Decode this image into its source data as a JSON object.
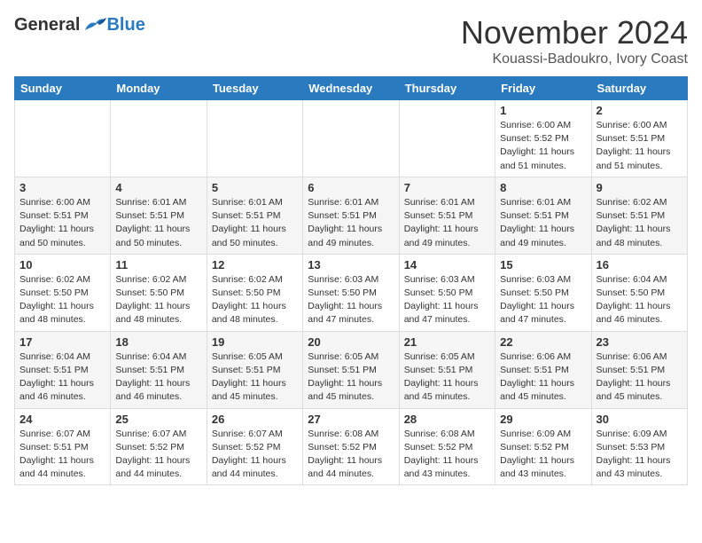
{
  "header": {
    "logo_general": "General",
    "logo_blue": "Blue",
    "month": "November 2024",
    "location": "Kouassi-Badoukro, Ivory Coast"
  },
  "weekdays": [
    "Sunday",
    "Monday",
    "Tuesday",
    "Wednesday",
    "Thursday",
    "Friday",
    "Saturday"
  ],
  "weeks": [
    [
      {
        "day": "",
        "info": ""
      },
      {
        "day": "",
        "info": ""
      },
      {
        "day": "",
        "info": ""
      },
      {
        "day": "",
        "info": ""
      },
      {
        "day": "",
        "info": ""
      },
      {
        "day": "1",
        "info": "Sunrise: 6:00 AM\nSunset: 5:52 PM\nDaylight: 11 hours\nand 51 minutes."
      },
      {
        "day": "2",
        "info": "Sunrise: 6:00 AM\nSunset: 5:51 PM\nDaylight: 11 hours\nand 51 minutes."
      }
    ],
    [
      {
        "day": "3",
        "info": "Sunrise: 6:00 AM\nSunset: 5:51 PM\nDaylight: 11 hours\nand 50 minutes."
      },
      {
        "day": "4",
        "info": "Sunrise: 6:01 AM\nSunset: 5:51 PM\nDaylight: 11 hours\nand 50 minutes."
      },
      {
        "day": "5",
        "info": "Sunrise: 6:01 AM\nSunset: 5:51 PM\nDaylight: 11 hours\nand 50 minutes."
      },
      {
        "day": "6",
        "info": "Sunrise: 6:01 AM\nSunset: 5:51 PM\nDaylight: 11 hours\nand 49 minutes."
      },
      {
        "day": "7",
        "info": "Sunrise: 6:01 AM\nSunset: 5:51 PM\nDaylight: 11 hours\nand 49 minutes."
      },
      {
        "day": "8",
        "info": "Sunrise: 6:01 AM\nSunset: 5:51 PM\nDaylight: 11 hours\nand 49 minutes."
      },
      {
        "day": "9",
        "info": "Sunrise: 6:02 AM\nSunset: 5:51 PM\nDaylight: 11 hours\nand 48 minutes."
      }
    ],
    [
      {
        "day": "10",
        "info": "Sunrise: 6:02 AM\nSunset: 5:50 PM\nDaylight: 11 hours\nand 48 minutes."
      },
      {
        "day": "11",
        "info": "Sunrise: 6:02 AM\nSunset: 5:50 PM\nDaylight: 11 hours\nand 48 minutes."
      },
      {
        "day": "12",
        "info": "Sunrise: 6:02 AM\nSunset: 5:50 PM\nDaylight: 11 hours\nand 48 minutes."
      },
      {
        "day": "13",
        "info": "Sunrise: 6:03 AM\nSunset: 5:50 PM\nDaylight: 11 hours\nand 47 minutes."
      },
      {
        "day": "14",
        "info": "Sunrise: 6:03 AM\nSunset: 5:50 PM\nDaylight: 11 hours\nand 47 minutes."
      },
      {
        "day": "15",
        "info": "Sunrise: 6:03 AM\nSunset: 5:50 PM\nDaylight: 11 hours\nand 47 minutes."
      },
      {
        "day": "16",
        "info": "Sunrise: 6:04 AM\nSunset: 5:50 PM\nDaylight: 11 hours\nand 46 minutes."
      }
    ],
    [
      {
        "day": "17",
        "info": "Sunrise: 6:04 AM\nSunset: 5:51 PM\nDaylight: 11 hours\nand 46 minutes."
      },
      {
        "day": "18",
        "info": "Sunrise: 6:04 AM\nSunset: 5:51 PM\nDaylight: 11 hours\nand 46 minutes."
      },
      {
        "day": "19",
        "info": "Sunrise: 6:05 AM\nSunset: 5:51 PM\nDaylight: 11 hours\nand 45 minutes."
      },
      {
        "day": "20",
        "info": "Sunrise: 6:05 AM\nSunset: 5:51 PM\nDaylight: 11 hours\nand 45 minutes."
      },
      {
        "day": "21",
        "info": "Sunrise: 6:05 AM\nSunset: 5:51 PM\nDaylight: 11 hours\nand 45 minutes."
      },
      {
        "day": "22",
        "info": "Sunrise: 6:06 AM\nSunset: 5:51 PM\nDaylight: 11 hours\nand 45 minutes."
      },
      {
        "day": "23",
        "info": "Sunrise: 6:06 AM\nSunset: 5:51 PM\nDaylight: 11 hours\nand 45 minutes."
      }
    ],
    [
      {
        "day": "24",
        "info": "Sunrise: 6:07 AM\nSunset: 5:51 PM\nDaylight: 11 hours\nand 44 minutes."
      },
      {
        "day": "25",
        "info": "Sunrise: 6:07 AM\nSunset: 5:52 PM\nDaylight: 11 hours\nand 44 minutes."
      },
      {
        "day": "26",
        "info": "Sunrise: 6:07 AM\nSunset: 5:52 PM\nDaylight: 11 hours\nand 44 minutes."
      },
      {
        "day": "27",
        "info": "Sunrise: 6:08 AM\nSunset: 5:52 PM\nDaylight: 11 hours\nand 44 minutes."
      },
      {
        "day": "28",
        "info": "Sunrise: 6:08 AM\nSunset: 5:52 PM\nDaylight: 11 hours\nand 43 minutes."
      },
      {
        "day": "29",
        "info": "Sunrise: 6:09 AM\nSunset: 5:52 PM\nDaylight: 11 hours\nand 43 minutes."
      },
      {
        "day": "30",
        "info": "Sunrise: 6:09 AM\nSunset: 5:53 PM\nDaylight: 11 hours\nand 43 minutes."
      }
    ]
  ]
}
